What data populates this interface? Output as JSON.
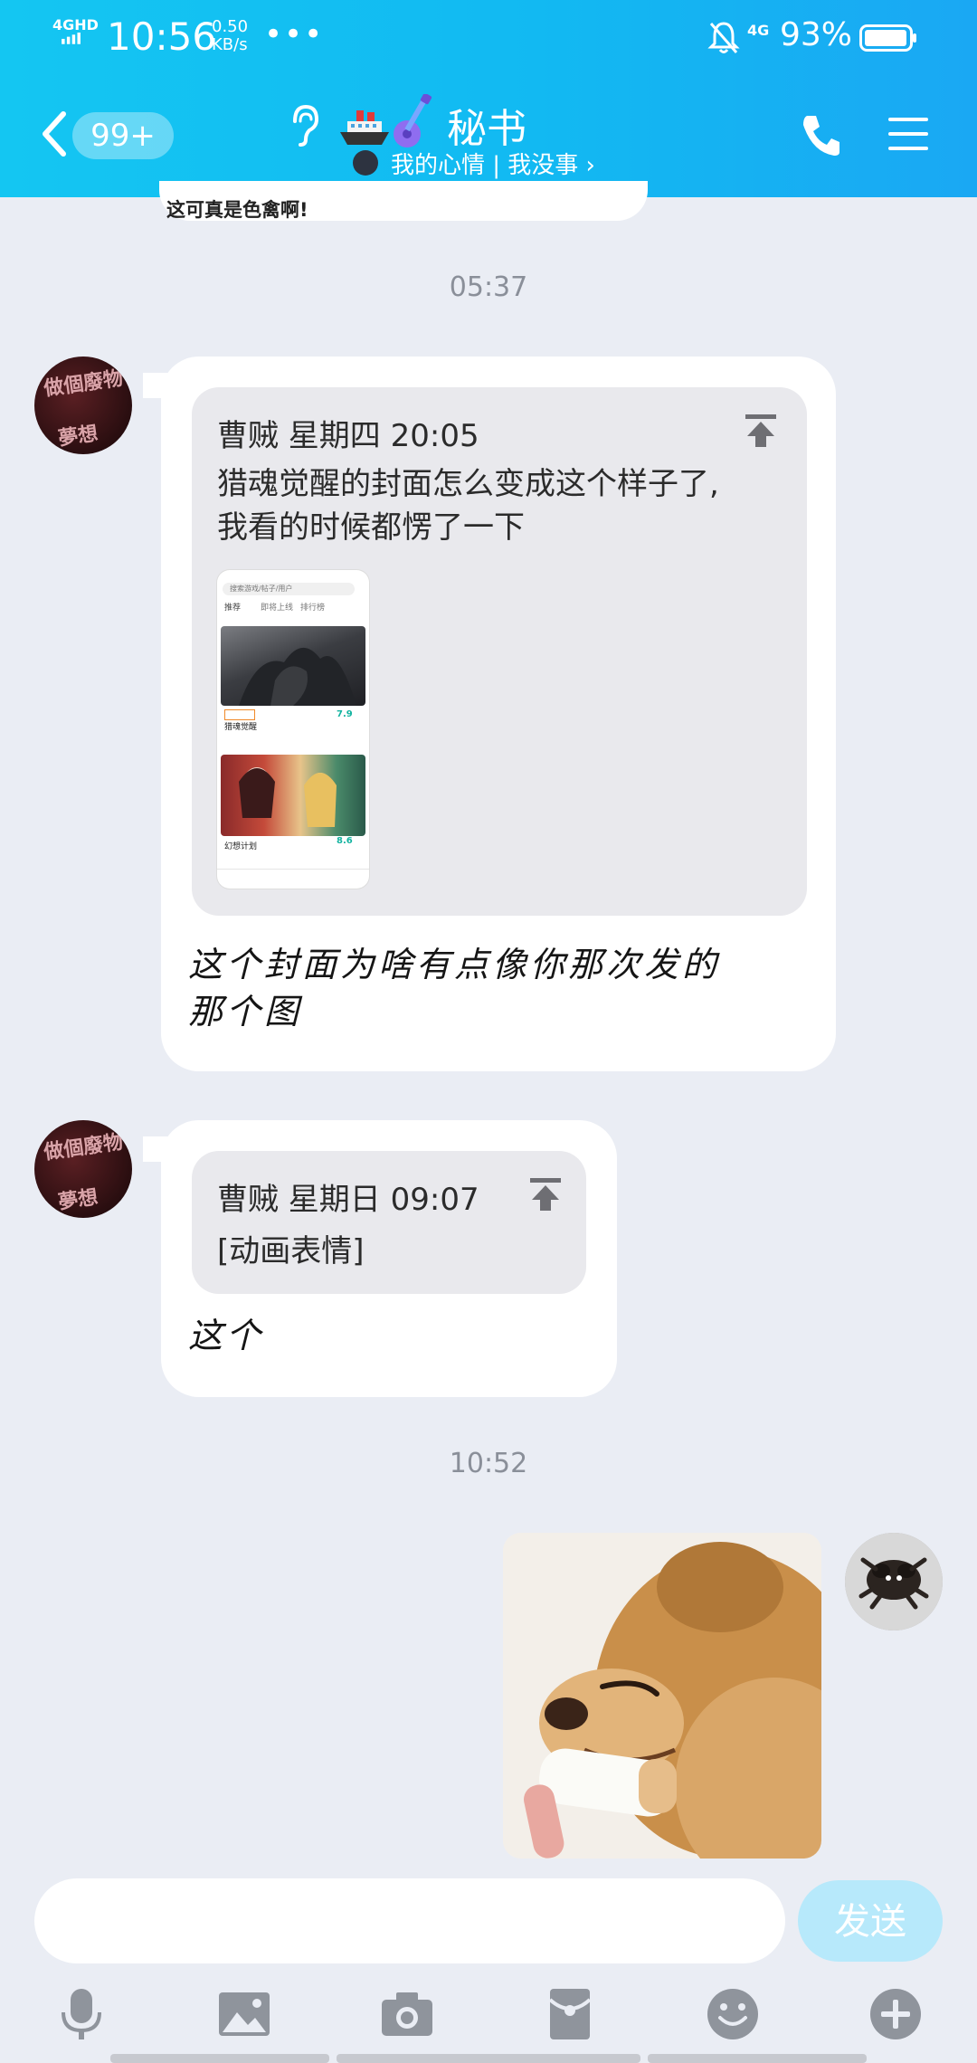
{
  "status_bar": {
    "signal_label": "4GHD",
    "time": "10:56",
    "net_speed_value": "0.50",
    "net_speed_unit": "KB/s",
    "more_dots": "•••",
    "network": "4G",
    "battery_percent": "93%"
  },
  "header": {
    "unread_badge": "99+",
    "title": "秘书",
    "status_text": "我的心情 | 我没事 ›"
  },
  "messages": {
    "previous_text": "这可真是色禽啊!",
    "time_1": "05:37",
    "msg1": {
      "quote_meta": "曹贼 星期四 20:05",
      "quote_line1": "猎魂觉醒的封面怎么变成这个样子了,",
      "quote_line2": "我看的时候都愣了一下",
      "thumb_search": "搜索游戏/帖子/用户",
      "thumb_tabs": [
        "推荐",
        "即将上线",
        "排行榜"
      ],
      "thumb_game1": "猎魂觉醒",
      "thumb_score1": "7.9",
      "thumb_game2": "幻想计划",
      "thumb_score2": "8.6",
      "reply_line1": "这个封面为啥有点像你那次发的",
      "reply_line2": "那个图"
    },
    "msg2": {
      "quote_meta": "曹贼 星期日 09:07",
      "quote_text": "[动画表情]",
      "reply": "这个"
    },
    "time_2": "10:52",
    "avatar_text_1": "做個廢物",
    "avatar_text_2": "夢想"
  },
  "input": {
    "placeholder": "",
    "send_label": "发送"
  },
  "toolbar": {
    "icons": [
      "microphone-icon",
      "image-icon",
      "camera-icon",
      "red-packet-icon",
      "emoji-icon",
      "plus-icon"
    ]
  },
  "colors": {
    "header_start": "#14c6f2",
    "header_end": "#1aa8f3",
    "background": "#eaedf4",
    "send_button": "#b7e9fb",
    "toolbar_icon": "#8f949c"
  }
}
